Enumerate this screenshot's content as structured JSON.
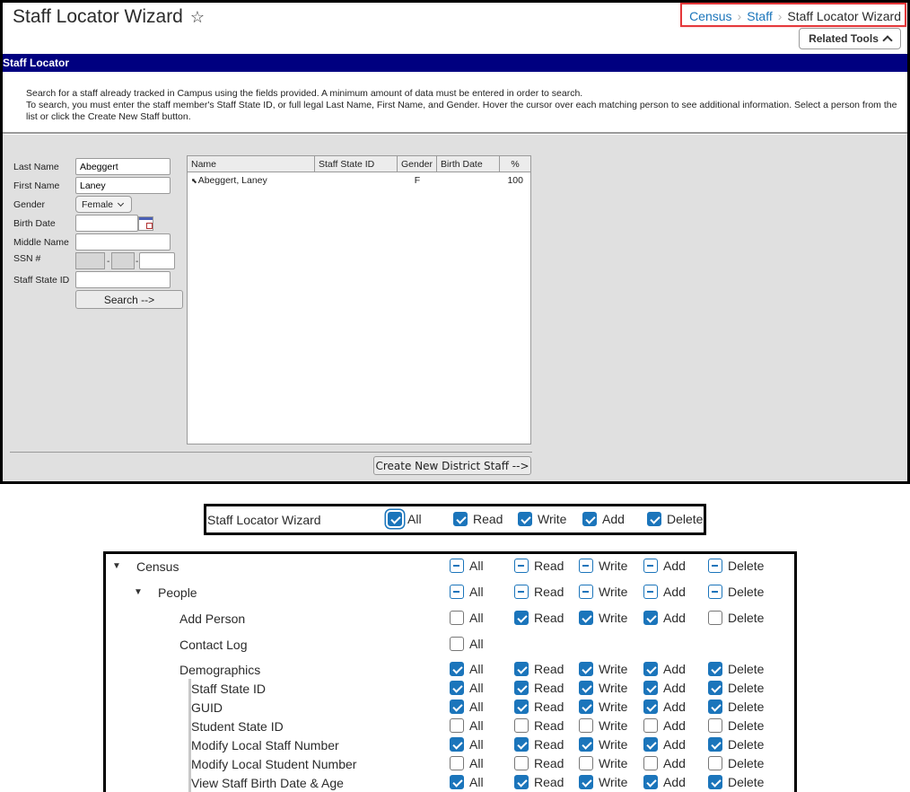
{
  "header": {
    "title": "Staff Locator Wizard",
    "breadcrumb": [
      "Census",
      "Staff",
      "Staff Locator Wizard"
    ],
    "related_tools": "Related Tools"
  },
  "section": {
    "title": "Staff Locator"
  },
  "intro": {
    "line1": "Search for a staff already tracked in Campus using the fields provided. A minimum amount of data must be entered in order to search.",
    "line2": "To search, you must enter the staff member's Staff State ID, or full legal Last Name, First Name, and Gender. Hover the cursor over each matching person to see additional information. Select a person from the list or click the Create New Staff button."
  },
  "form": {
    "labels": {
      "last_name": "Last Name",
      "first_name": "First Name",
      "gender": "Gender",
      "birth_date": "Birth Date",
      "middle_name": "Middle Name",
      "ssn": "SSN #",
      "staff_state_id": "Staff State ID"
    },
    "values": {
      "last_name": "Abeggert",
      "first_name": "Laney",
      "gender": "Female",
      "birth_date": "",
      "middle_name": "",
      "ssn3": "",
      "staff_state_id": ""
    },
    "ssn_dash": "-",
    "search_button": "Search -->"
  },
  "results": {
    "columns": [
      "Name",
      "Staff State ID",
      "Gender",
      "Birth Date",
      "%"
    ],
    "rows": [
      {
        "name": "Abeggert, Laney",
        "staff_state_id": "",
        "gender": "F",
        "birth_date": "",
        "pct": "100"
      }
    ]
  },
  "create_button": "Create New District Staff -->",
  "permission_labels": {
    "all": "All",
    "read": "Read",
    "write": "Write",
    "add": "Add",
    "delete": "Delete"
  },
  "wizard_permission": {
    "label": "Staff Locator Wizard",
    "all": "checked",
    "read": "checked",
    "write": "checked",
    "add": "checked",
    "delete": "checked"
  },
  "tool_rights": [
    {
      "label": "Census",
      "expanded": true,
      "all": "partial",
      "read": "partial",
      "write": "partial",
      "add": "partial",
      "delete": "partial"
    },
    {
      "label": "People",
      "expanded": true,
      "all": "partial",
      "read": "partial",
      "write": "partial",
      "add": "partial",
      "delete": "partial"
    },
    {
      "label": "Add Person",
      "all": "unchecked",
      "read": "checked",
      "write": "checked",
      "add": "checked",
      "delete": "unchecked"
    },
    {
      "label": "Contact Log",
      "all": "unchecked"
    },
    {
      "label": "Demographics",
      "all": "checked",
      "read": "checked",
      "write": "checked",
      "add": "checked",
      "delete": "checked"
    },
    {
      "label": "Staff State ID",
      "all": "checked",
      "read": "checked",
      "write": "checked",
      "add": "checked",
      "delete": "checked"
    },
    {
      "label": "GUID",
      "all": "checked",
      "read": "checked",
      "write": "checked",
      "add": "checked",
      "delete": "checked"
    },
    {
      "label": "Student State ID",
      "all": "unchecked",
      "read": "unchecked",
      "write": "unchecked",
      "add": "unchecked",
      "delete": "unchecked"
    },
    {
      "label": "Modify Local Staff Number",
      "all": "checked",
      "read": "checked",
      "write": "checked",
      "add": "checked",
      "delete": "checked"
    },
    {
      "label": "Modify Local Student Number",
      "all": "unchecked",
      "read": "unchecked",
      "write": "unchecked",
      "add": "unchecked",
      "delete": "unchecked"
    },
    {
      "label": "View Staff Birth Date & Age",
      "all": "checked",
      "read": "checked",
      "write": "checked",
      "add": "checked",
      "delete": "checked"
    }
  ],
  "colors": {
    "section_bar": "#000080",
    "accent": "#1b75bb",
    "highlight_box": "#e5383b",
    "panel_bg": "#e0e0e0"
  }
}
